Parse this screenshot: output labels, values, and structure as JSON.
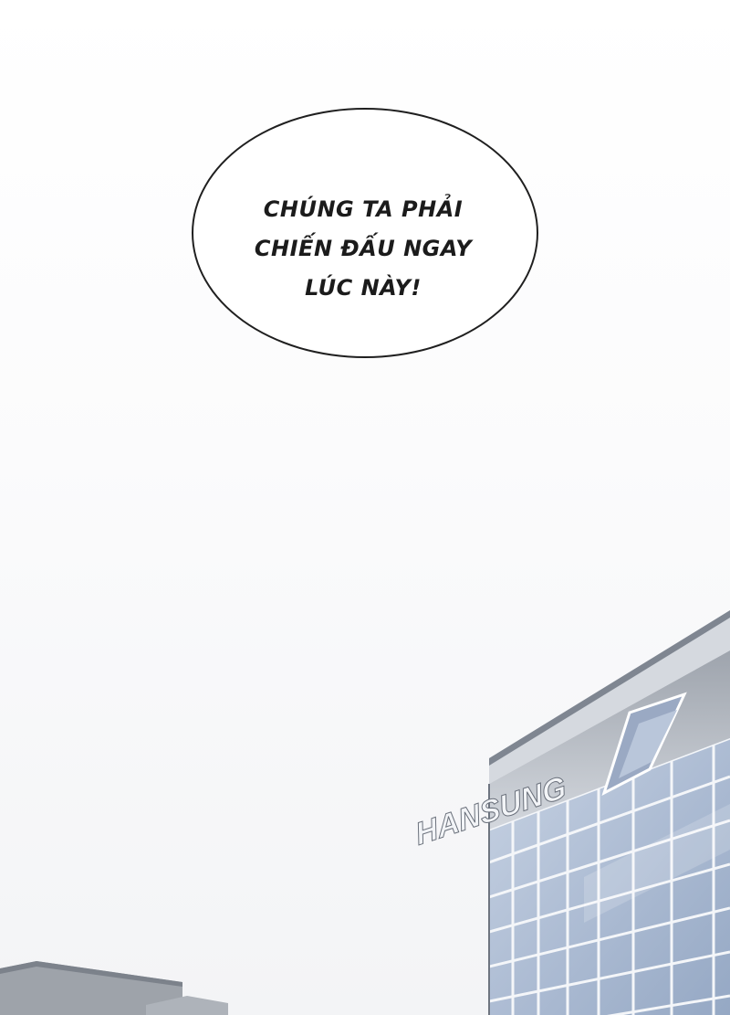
{
  "speech_bubble": {
    "lines": [
      "CHÚNG TA PHẢI",
      "CHIẾN ĐẤU NGAY",
      "LÚC NÀY!"
    ]
  },
  "building": {
    "sign_text": "HANSUNG",
    "glass_color": "#aebdd4",
    "frame_color": "#f4f6f9"
  }
}
